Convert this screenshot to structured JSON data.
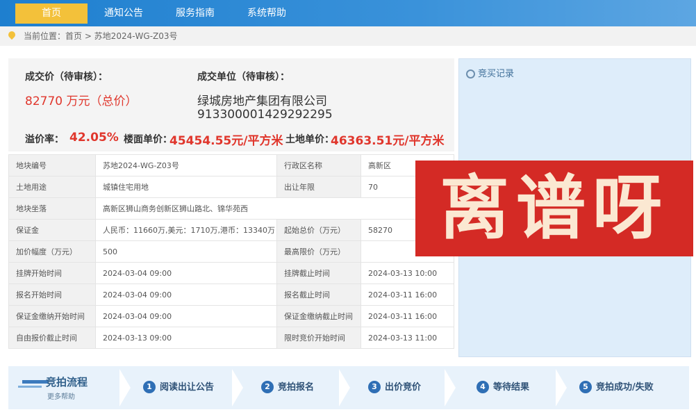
{
  "nav": {
    "items": [
      "首页",
      "通知公告",
      "服务指南",
      "系统帮助"
    ]
  },
  "breadcrumb": {
    "text": "当前位置：首页 > 苏地2024-WG-Z03号"
  },
  "summary": {
    "price_label": "成交价（待审核）：",
    "price_value": "82770 万元（总价）",
    "unit_label": "成交单位（待审核）：",
    "unit_name": "绿城房地产集团有限公司",
    "unit_code": "913300001429292295",
    "premium_label": "溢价率：",
    "premium_value": "42.05%",
    "floor_label": "楼面单价：",
    "floor_value": "45454.55元/平方米",
    "land_label": "土地单价：",
    "land_value": "46363.51元/平方米"
  },
  "table": {
    "rows": [
      {
        "k1": "地块编号",
        "v1": "苏地2024-WG-Z03号",
        "k2": "行政区名称",
        "v2": "高新区"
      },
      {
        "k1": "土地用途",
        "v1": "城镇住宅用地",
        "k2": "出让年限",
        "v2": "70"
      },
      {
        "k1": "地块坐落",
        "v1": "高新区狮山商务创新区狮山路北、锦华苑西",
        "k2": "",
        "v2": ""
      },
      {
        "k1": "保证金",
        "v1": "人民币：11660万,美元：1710万,港币：13340万",
        "k2": "起始总价（万元）",
        "v2": "58270"
      },
      {
        "k1": "加价幅度（万元）",
        "v1": "500",
        "k2": "最高限价（万元）",
        "v2": ""
      },
      {
        "k1": "挂牌开始时间",
        "v1": "2024-03-04 09:00",
        "k2": "挂牌截止时间",
        "v2": "2024-03-13 10:00"
      },
      {
        "k1": "报名开始时间",
        "v1": "2024-03-04 09:00",
        "k2": "报名截止时间",
        "v2": "2024-03-11 16:00"
      },
      {
        "k1": "保证金缴纳开始时间",
        "v1": "2024-03-04 09:00",
        "k2": "保证金缴纳截止时间",
        "v2": "2024-03-11 16:00"
      },
      {
        "k1": "自由报价截止时间",
        "v1": "2024-03-13 09:00",
        "k2": "限时竞价开始时间",
        "v2": "2024-03-13 11:00"
      }
    ]
  },
  "right_panel": {
    "title": "竞买记录"
  },
  "stamp": {
    "text": "离谱呀"
  },
  "process": {
    "title": "竞拍流程",
    "more": "更多帮助",
    "steps": [
      {
        "num": "1",
        "label": "阅读出让公告"
      },
      {
        "num": "2",
        "label": "竞拍报名"
      },
      {
        "num": "3",
        "label": "出价竞价"
      },
      {
        "num": "4",
        "label": "等待结果"
      },
      {
        "num": "5",
        "label": "竞拍成功/失败"
      }
    ]
  }
}
